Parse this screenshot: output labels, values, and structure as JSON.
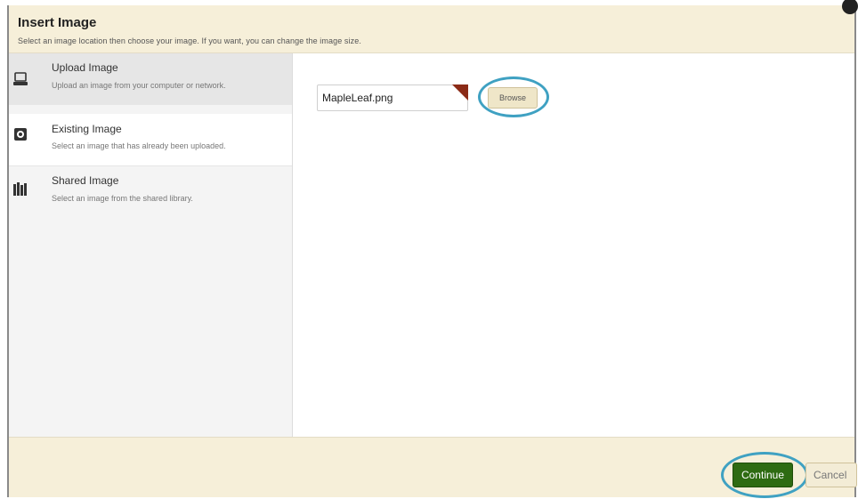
{
  "header": {
    "title": "Insert Image",
    "subtitle": "Select an image location then choose your image. If you want, you can change the image size."
  },
  "sidebar": {
    "items": [
      {
        "title": "Upload Image",
        "desc": "Upload an image from your computer or network.",
        "icon": "laptop-icon",
        "active": true
      },
      {
        "title": "Existing Image",
        "desc": "Select an image that has already been uploaded.",
        "icon": "image-folder-icon",
        "active": false
      },
      {
        "title": "Shared Image",
        "desc": "Select an image from the shared library.",
        "icon": "books-icon",
        "active": false
      }
    ]
  },
  "upload": {
    "file_value": "MapleLeaf.png",
    "browse_label": "Browse"
  },
  "footer": {
    "continue_label": "Continue",
    "cancel_label": "Cancel"
  },
  "colors": {
    "header_bg": "#f6efd9",
    "continue_bg": "#2e6b12",
    "highlight_ring": "#3fa1c2",
    "flag": "#8b2b17"
  }
}
